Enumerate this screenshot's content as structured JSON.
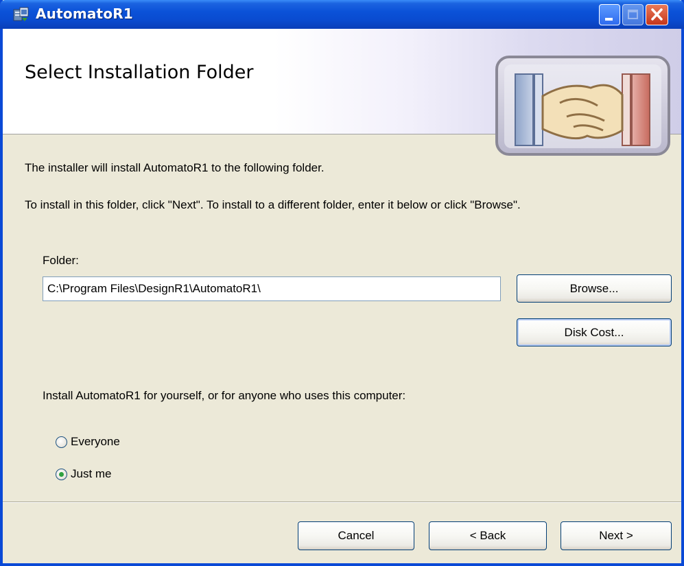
{
  "window": {
    "title": "AutomatoR1"
  },
  "banner": {
    "title": "Select Installation Folder"
  },
  "body": {
    "intro_line": "The installer will install AutomatoR1 to the following folder.",
    "instructions_line": "To install in this folder, click \"Next\". To install to a different folder, enter it below or click \"Browse\".",
    "folder_label": "Folder:",
    "folder_value": "C:\\Program Files\\DesignR1\\AutomatoR1\\",
    "browse_label": "Browse...",
    "disk_cost_label": "Disk Cost...",
    "install_for_prompt": "Install AutomatoR1 for yourself, or for anyone who uses this computer:",
    "radio_everyone_label": "Everyone",
    "radio_justme_label": "Just me",
    "selected_option": "Just me"
  },
  "footer": {
    "cancel_label": "Cancel",
    "back_label": "< Back",
    "next_label": "Next >"
  },
  "colors": {
    "titlebar": "#0a4bd0",
    "dialog_bg": "#ece9d8",
    "radio_checked": "#2fa140"
  }
}
